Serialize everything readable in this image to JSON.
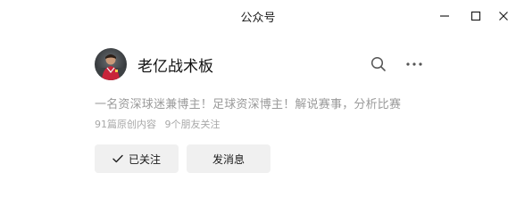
{
  "window": {
    "title": "公众号",
    "controls": [
      "minimize-icon",
      "maximize-icon",
      "close-icon"
    ]
  },
  "account": {
    "name": "老亿战术板",
    "bio": "一名资深球迷兼博主！足球资深博主！解说赛事，分析比赛",
    "articles": "91篇原创内容",
    "friends": "9个朋友关注"
  },
  "actions": {
    "follow_label": "已关注",
    "message_label": "发消息"
  },
  "icons": {
    "search": "search-icon",
    "more": "more-icon",
    "check": "check-icon"
  },
  "colors": {
    "background": "#ffffff",
    "button_bg": "#f0f0f0",
    "muted_text": "#9a9a9a"
  }
}
